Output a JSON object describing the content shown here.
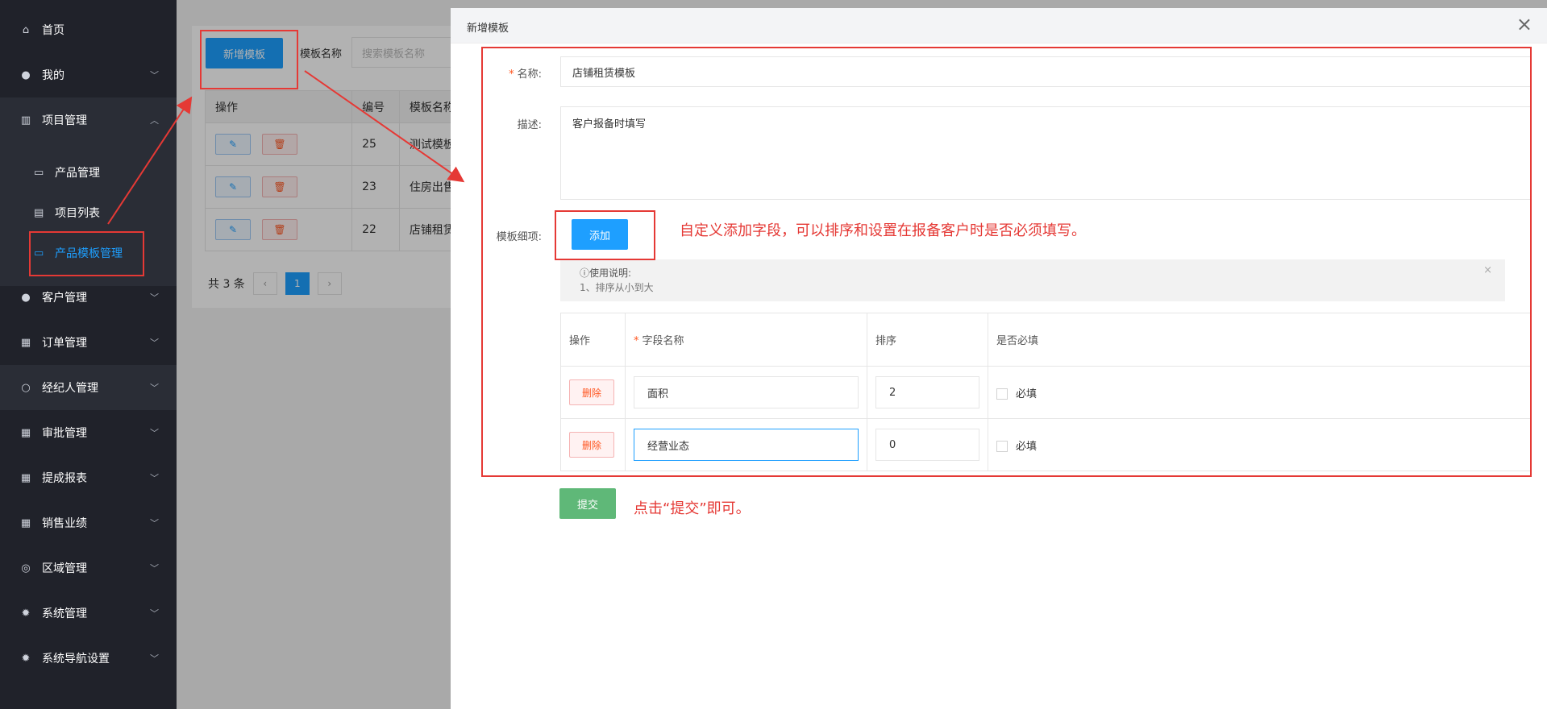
{
  "sidebar": {
    "items": [
      {
        "label": "首页",
        "icon": "home-icon"
      },
      {
        "label": "我的",
        "icon": "user-icon"
      },
      {
        "label": "项目管理",
        "icon": "chart-icon"
      },
      {
        "label": "客户管理",
        "icon": "user-icon"
      },
      {
        "label": "订单管理",
        "icon": "clipboard-icon"
      },
      {
        "label": "经纪人管理",
        "icon": "person-icon"
      },
      {
        "label": "审批管理",
        "icon": "grid-icon"
      },
      {
        "label": "提成报表",
        "icon": "grid-icon"
      },
      {
        "label": "销售业绩",
        "icon": "grid-icon"
      },
      {
        "label": "区域管理",
        "icon": "map-pin-icon"
      },
      {
        "label": "系统管理",
        "icon": "gear-icon"
      },
      {
        "label": "系统导航设置",
        "icon": "gear-icon"
      }
    ],
    "sub_items": [
      {
        "label": "产品管理",
        "icon": "chat-icon"
      },
      {
        "label": "项目列表",
        "icon": "building-icon"
      },
      {
        "label": "产品模板管理",
        "icon": "chat-icon"
      }
    ]
  },
  "background_page": {
    "add_button": "新增模板",
    "search_label": "模板名称",
    "search_placeholder": "搜索模板名称",
    "columns": [
      "操作",
      "编号",
      "模板名称"
    ],
    "rows": [
      {
        "id": "25",
        "name": "测试模板"
      },
      {
        "id": "23",
        "name": "住房出售"
      },
      {
        "id": "22",
        "name": "店铺租赁"
      }
    ],
    "total": "共 3 条",
    "current_page": "1"
  },
  "drawer": {
    "title": "新增模板",
    "name_label": "名称:",
    "name_value": "店铺租赁模板",
    "desc_label": "描述:",
    "desc_value": "客户报备时填写",
    "detail_label": "模板细项:",
    "add_button": "添加",
    "tip_title": "使用说明:",
    "tip_text": "1、排序从小到大",
    "table_headers": [
      "操作",
      "字段名称",
      "排序",
      "是否必填"
    ],
    "rows": [
      {
        "delete": "删除",
        "field": "面积",
        "order": "2",
        "required": "必填"
      },
      {
        "delete": "删除",
        "field": "经营业态",
        "order": "0",
        "required": "必填"
      }
    ],
    "submit_button": "提交"
  },
  "annotations": {
    "add_note": "自定义添加字段，可以排序和设置在报备客户时是否必须填写。",
    "submit_note": "点击“提交”即可。"
  },
  "colors": {
    "accent": "#1e9fff",
    "annotation": "#e53935",
    "submit": "#5fb878",
    "sidebar": "#20222a"
  }
}
